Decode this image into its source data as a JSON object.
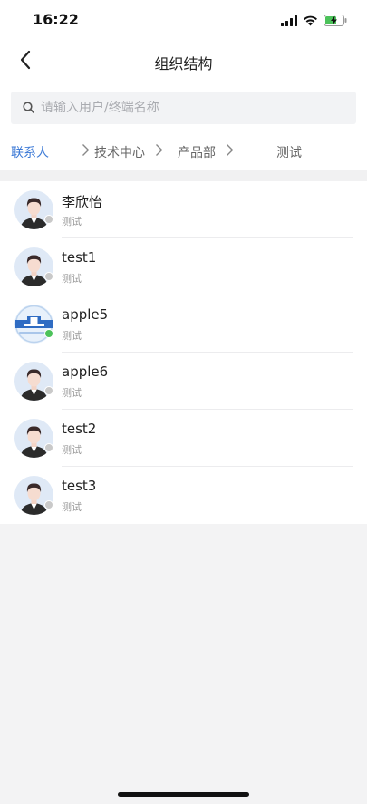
{
  "status_bar": {
    "time": "16:22"
  },
  "nav": {
    "title": "组织结构"
  },
  "search": {
    "placeholder": "请输入用户/终端名称"
  },
  "breadcrumb": {
    "items": [
      "联系人",
      "技术中心",
      "产品部",
      "测试"
    ]
  },
  "contacts": [
    {
      "name": "李欣怡",
      "dept": "测试",
      "avatar": "person-avatar-icon",
      "online": false
    },
    {
      "name": "test1",
      "dept": "测试",
      "avatar": "person-avatar-icon",
      "online": false
    },
    {
      "name": "apple5",
      "dept": "测试",
      "avatar": "terminal-device-icon",
      "online": true
    },
    {
      "name": "apple6",
      "dept": "测试",
      "avatar": "person-avatar-icon",
      "online": false
    },
    {
      "name": "test2",
      "dept": "测试",
      "avatar": "person-avatar-icon",
      "online": false
    },
    {
      "name": "test3",
      "dept": "测试",
      "avatar": "person-avatar-icon",
      "online": false
    }
  ],
  "colors": {
    "accent": "#3d7ad6",
    "online": "#4cc25a",
    "offline": "#c9c9c9"
  }
}
